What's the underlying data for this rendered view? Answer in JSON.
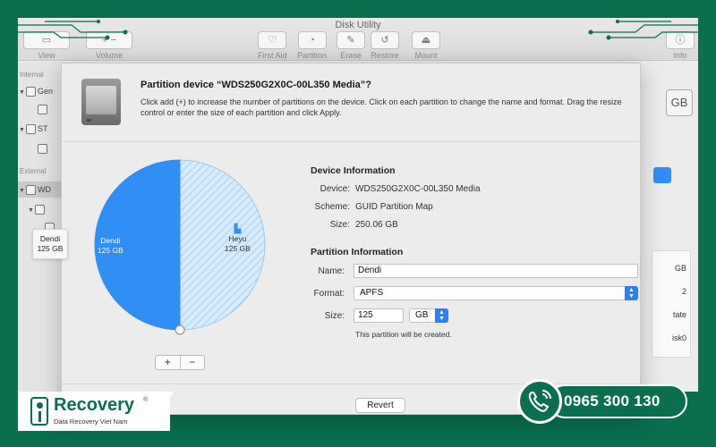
{
  "window": {
    "title": "Disk Utility",
    "toolbar": [
      {
        "label": "View",
        "glyph": "▭"
      },
      {
        "label": "Volume",
        "glyph": "+ −"
      },
      {
        "label": "First Aid",
        "glyph": "♡"
      },
      {
        "label": "Partition",
        "glyph": "◔"
      },
      {
        "label": "Erase",
        "glyph": "✎"
      },
      {
        "label": "Restore",
        "glyph": "↺"
      },
      {
        "label": "Mount",
        "glyph": "⏏"
      },
      {
        "label": "Info",
        "glyph": "ⓘ"
      }
    ]
  },
  "sidebar": {
    "internal_label": "Internal",
    "external_label": "External",
    "items": [
      {
        "label": "Gen"
      },
      {
        "label": ""
      },
      {
        "label": "ST"
      },
      {
        "label": ""
      },
      {
        "label": "WD"
      },
      {
        "label": ""
      },
      {
        "label": ""
      }
    ]
  },
  "peek": {
    "gb": "GB",
    "col": [
      "GB",
      "2",
      "tate",
      "isk0"
    ]
  },
  "dialog": {
    "title": "Partition device “WDS250G2X0C-00L350 Media”?",
    "description": "Click add (+) to increase the number of partitions on the device. Click on each partition to change the name and format. Drag the resize control or enter the size of each partition and click Apply.",
    "device_info_title": "Device Information",
    "device": {
      "label": "Device:",
      "value": "WDS250G2X0C-00L350 Media"
    },
    "scheme": {
      "label": "Scheme:",
      "value": "GUID Partition Map"
    },
    "size": {
      "label": "Size:",
      "value": "250.06 GB"
    },
    "partition_info_title": "Partition Information",
    "name": {
      "label": "Name:",
      "value": "Dendi"
    },
    "format": {
      "label": "Format:",
      "value": "APFS"
    },
    "psize": {
      "label": "Size:",
      "value": "125",
      "unit": "GB"
    },
    "note": "This partition will be created.",
    "add_label": "+",
    "remove_label": "−",
    "revert_label": "Revert"
  },
  "chart_data": {
    "type": "pie",
    "slices": [
      {
        "name": "Dendi",
        "size_label": "125 GB",
        "value": 125,
        "color": "#2f8ff5",
        "selected": true
      },
      {
        "name": "Heyu",
        "size_label": "125 GB",
        "value": 125,
        "color": "#d6ebfb",
        "hatched": true
      }
    ]
  },
  "tooltip": {
    "name": "Dendi",
    "size": "125 GB"
  },
  "brand": {
    "name": "Recovery",
    "reg": "®",
    "subtitle": "Data Recovery Viet Nam",
    "phone": "0965 300 130",
    "accent": "#0b6e4f"
  }
}
